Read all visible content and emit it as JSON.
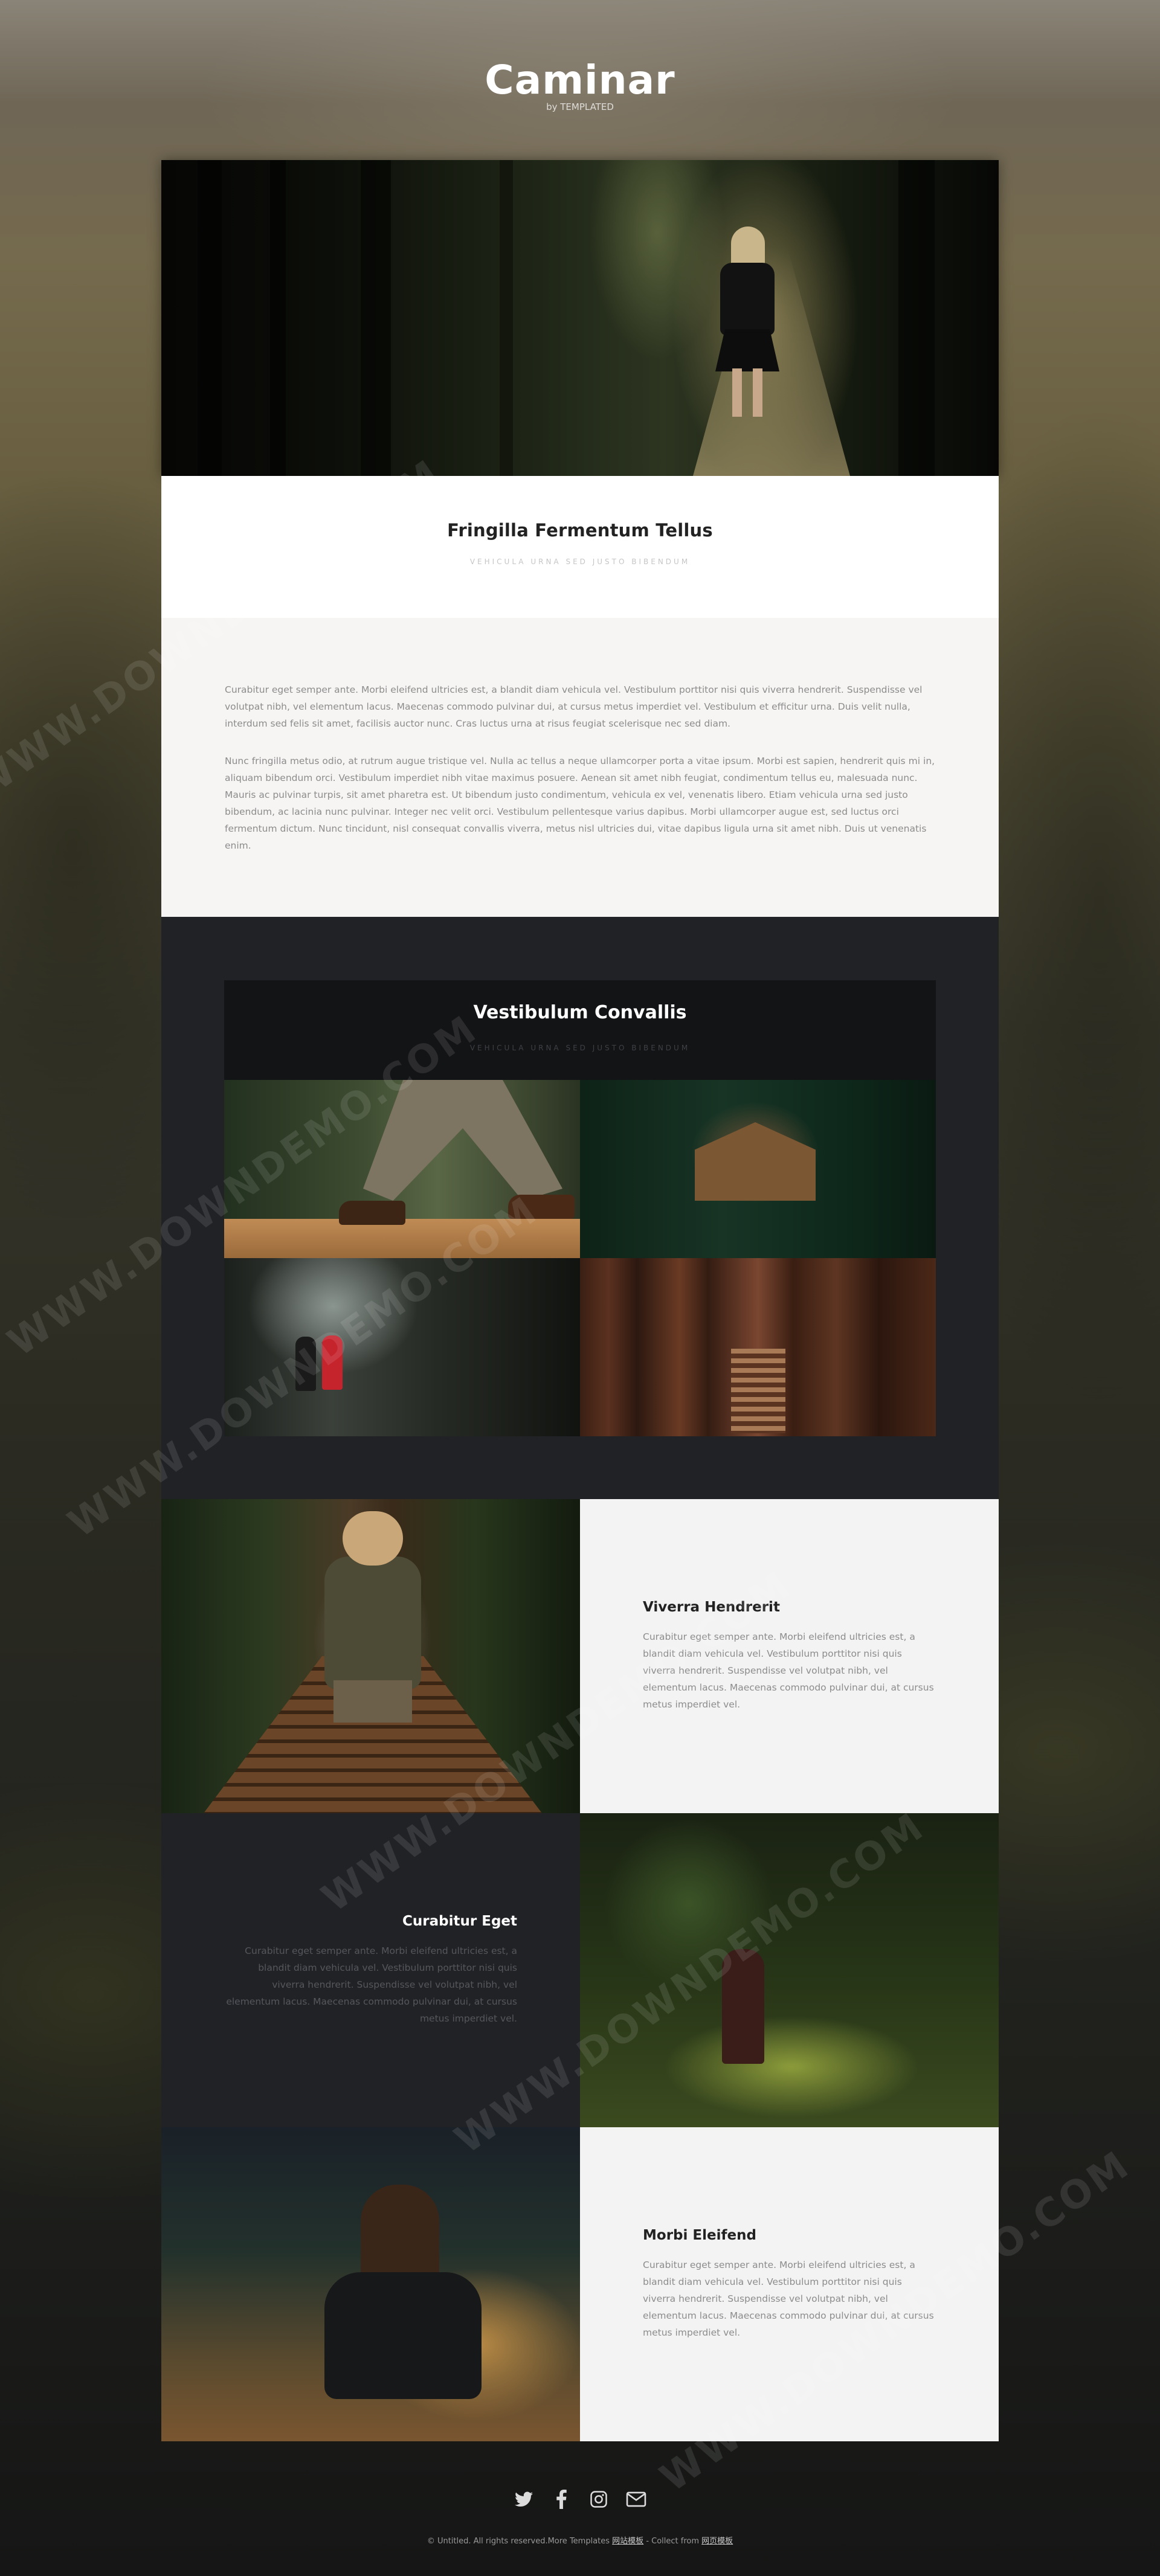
{
  "header": {
    "brand": "Caminar",
    "byline": "by TEMPLATED"
  },
  "intro": {
    "title": "Fringilla Fermentum Tellus",
    "subtitle": "VEHICULA URNA SED JUSTO BIBENDUM",
    "paragraphs": [
      "Curabitur eget semper ante. Morbi eleifend ultricies est, a blandit diam vehicula vel. Vestibulum porttitor nisi quis viverra hendrerit. Suspendisse vel volutpat nibh, vel elementum lacus. Maecenas commodo pulvinar dui, at cursus metus imperdiet vel. Vestibulum et efficitur urna. Duis velit nulla, interdum sed felis sit amet, facilisis auctor nunc. Cras luctus urna at risus feugiat scelerisque nec sed diam.",
      "Nunc fringilla metus odio, at rutrum augue tristique vel. Nulla ac tellus a neque ullamcorper porta a vitae ipsum. Morbi est sapien, hendrerit quis mi in, aliquam bibendum orci. Vestibulum imperdiet nibh vitae maximus posuere. Aenean sit amet nibh feugiat, condimentum tellus eu, malesuada nunc. Mauris ac pulvinar turpis, sit amet pharetra est. Ut bibendum justo condimentum, vehicula ex vel, venenatis libero. Etiam vehicula urna sed justo bibendum, ac lacinia nunc pulvinar. Integer nec velit orci. Vestibulum pellentesque varius dapibus. Morbi ullamcorper augue est, sed luctus orci fermentum dictum. Nunc tincidunt, nisl consequat convallis viverra, metus nisl ultricies dui, vitae dapibus ligula urna sit amet nibh. Duis ut venenatis enim."
    ]
  },
  "gallery": {
    "title": "Vestibulum Convallis",
    "subtitle": "VEHICULA URNA SED JUSTO BIBENDUM"
  },
  "features": [
    {
      "title": "Viverra Hendrerit",
      "text": "Curabitur eget semper ante. Morbi eleifend ultricies est, a blandit diam vehicula vel. Vestibulum porttitor nisi quis viverra hendrerit. Suspendisse vel volutpat nibh, vel elementum lacus. Maecenas commodo pulvinar dui, at cursus metus imperdiet vel."
    },
    {
      "title": "Curabitur Eget",
      "text": "Curabitur eget semper ante. Morbi eleifend ultricies est, a blandit diam vehicula vel. Vestibulum porttitor nisi quis viverra hendrerit. Suspendisse vel volutpat nibh, vel elementum lacus. Maecenas commodo pulvinar dui, at cursus metus imperdiet vel."
    },
    {
      "title": "Morbi Eleifend",
      "text": "Curabitur eget semper ante. Morbi eleifend ultricies est, a blandit diam vehicula vel. Vestibulum porttitor nisi quis viverra hendrerit. Suspendisse vel volutpat nibh, vel elementum lacus. Maecenas commodo pulvinar dui, at cursus metus imperdiet vel."
    }
  ],
  "footer": {
    "socials": [
      "twitter-icon",
      "facebook-icon",
      "instagram-icon",
      "envelope-icon"
    ],
    "copyright_prefix": "© Untitled. All rights reserved.More Templates",
    "link1": "网站模板",
    "copyright_middle": " - Collect from ",
    "link2": "网页模板"
  },
  "watermark": "WWW.DOWNDEMO.COM"
}
